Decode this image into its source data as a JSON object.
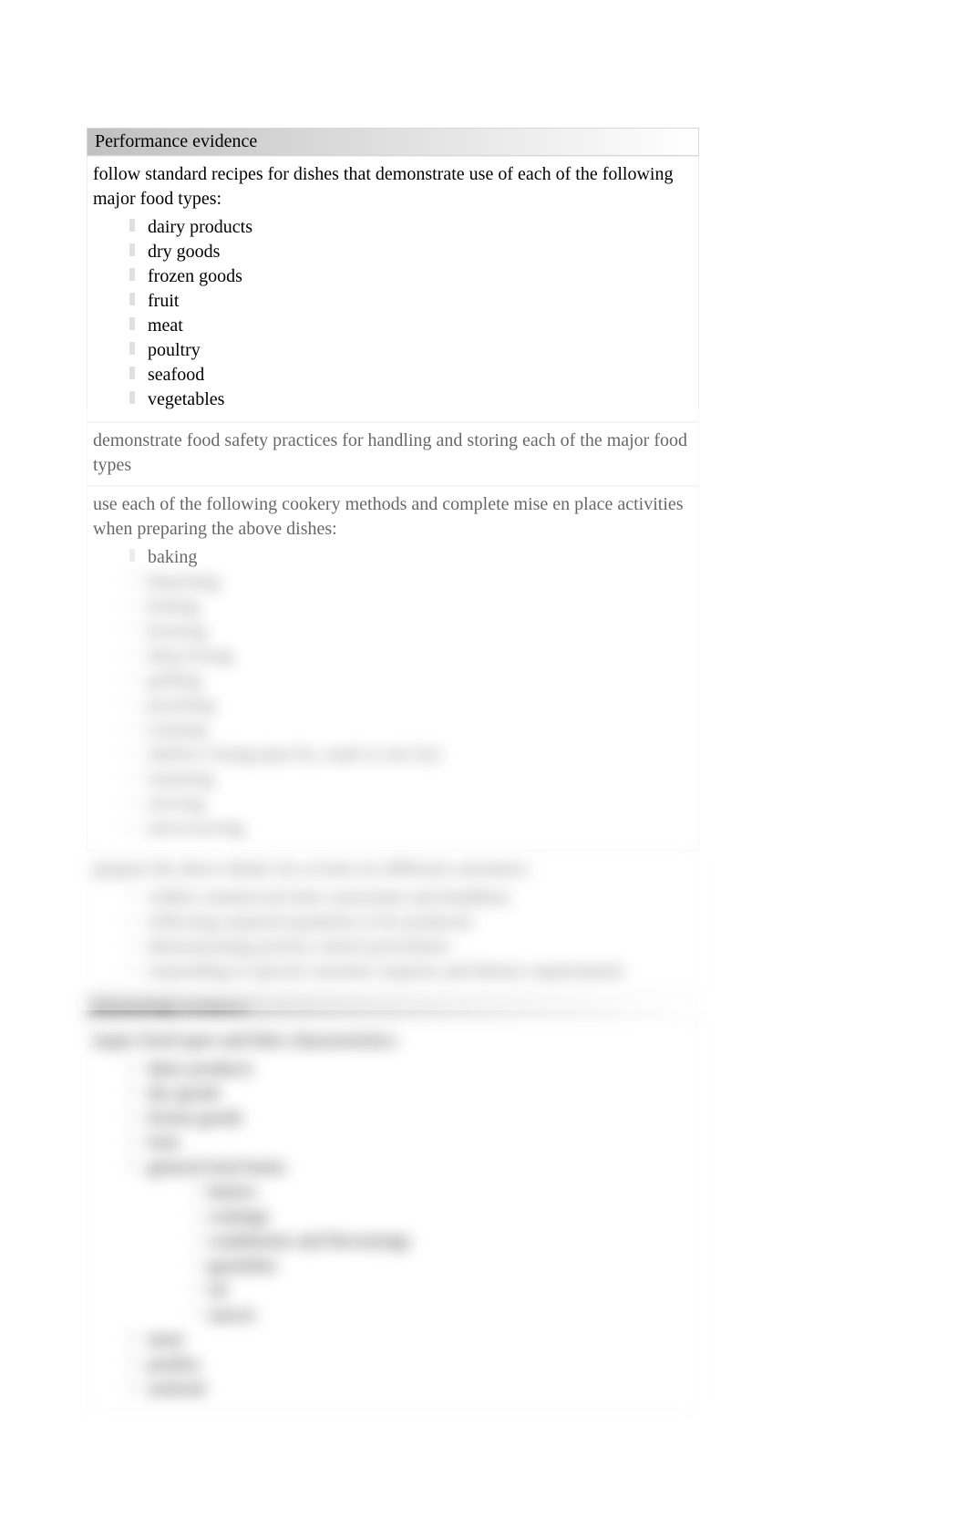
{
  "headers": {
    "performance_evidence": "Performance evidence",
    "knowledge_evidence": "Knowledge evidence"
  },
  "pe": {
    "intro1": "follow standard recipes for dishes that demonstrate use of each of the following major food types:",
    "list1": {
      "i0": "dairy products",
      "i1": "dry goods",
      "i2": "frozen goods",
      "i3": "fruit",
      "i4": "meat",
      "i5": "poultry",
      "i6": "seafood",
      "i7": "vegetables"
    },
    "intro2": "demonstrate food safety practices for handling and storing each of the major food types",
    "intro3": "use each of the following cookery methods and complete mise en place activities when preparing the above dishes:",
    "list3": {
      "i0": "baking",
      "i1": "blanching",
      "i2": "boiling",
      "i3": "braising",
      "i4": "deep-frying",
      "i5": "grilling",
      "i6": "poaching",
      "i7": "roasting",
      "i8": "shallow frying (pan fry, sauté or stir fry)",
      "i9": "steaming",
      "i10": "stewing",
      "i11": "microwaving"
    },
    "intro4": "prepare the above dishes for at least six different customers:",
    "list4": {
      "i0": "within commercial time constraints and deadlines",
      "i1": "reflecting required quantities to be produced",
      "i2": "demonstrating portion control procedures",
      "i3": "responding to special customer requests and dietary requirements"
    }
  },
  "ke": {
    "intro1": "major food types and their characteristics:",
    "list1": {
      "i0": "dairy products",
      "i1": "dry goods",
      "i2": "frozen goods",
      "i3": "fruit",
      "i4": "general food items:",
      "sub4": {
        "s0": "batters",
        "s1": "coatings",
        "s2": "condiments and flavourings",
        "s3": "garnishes",
        "s4": "oil",
        "s5": "sauces"
      },
      "i5": "meat",
      "i6": "poultry",
      "i7": "seafood"
    }
  }
}
